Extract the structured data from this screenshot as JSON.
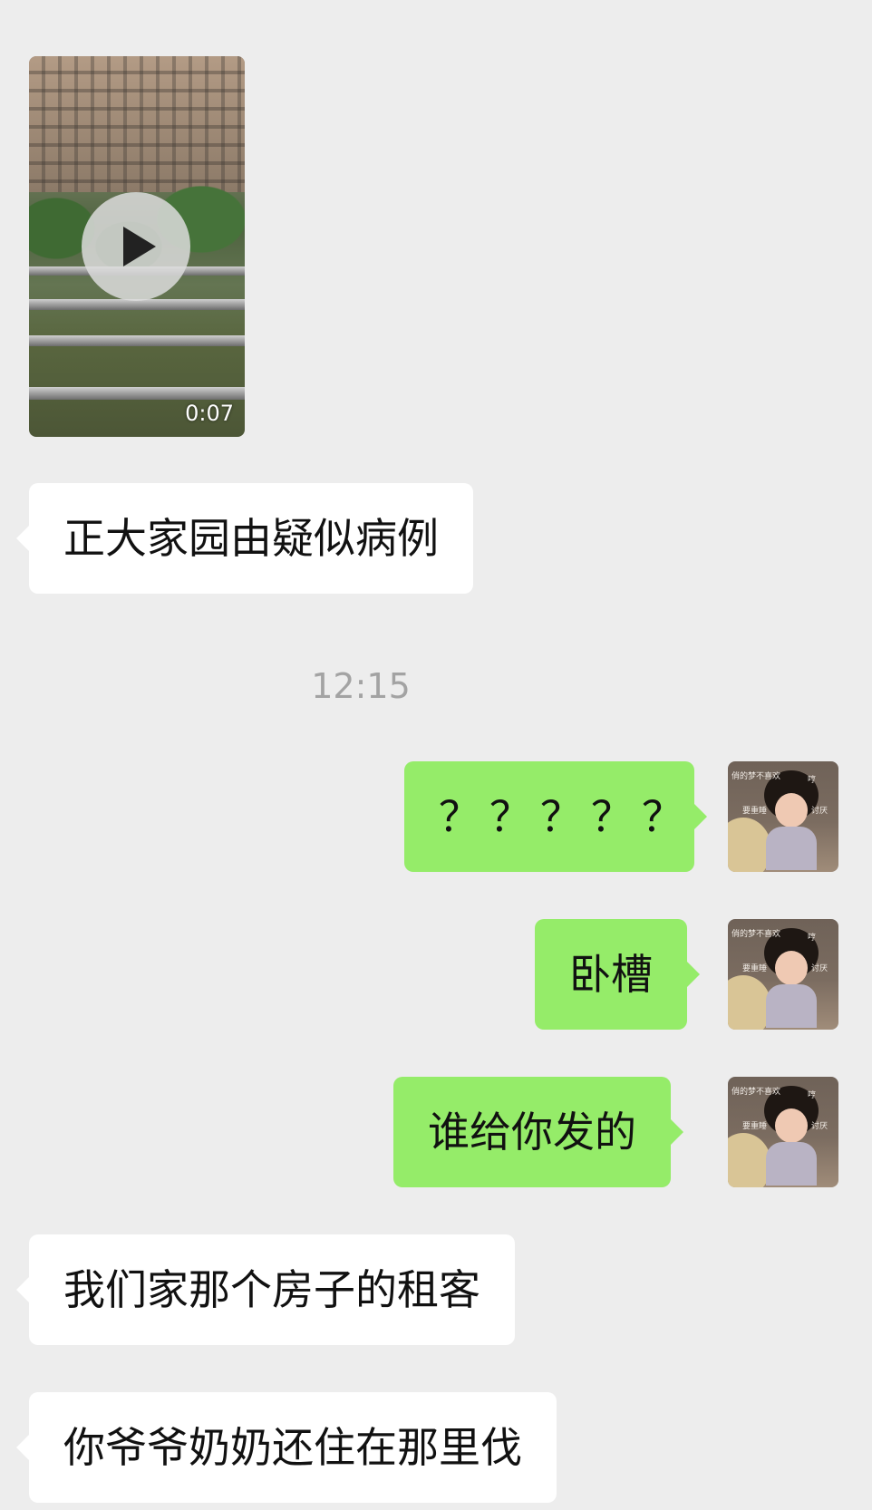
{
  "chat": {
    "video": {
      "duration": "0:07",
      "play_icon": "play-icon"
    },
    "messages": [
      {
        "side": "left",
        "text": "正大家园由疑似病例"
      },
      {
        "side": "right",
        "text": "？？？？？"
      },
      {
        "side": "right",
        "text": "卧槽"
      },
      {
        "side": "right",
        "text": "谁给你发的"
      },
      {
        "side": "left",
        "text": "我们家那个房子的租客"
      },
      {
        "side": "left",
        "text": "你爷爷奶奶还住在那里伐"
      }
    ],
    "timestamp": "12:15",
    "avatar_text": {
      "top": "俏的梦不喜欢",
      "right": "哼",
      "left": "要重睡",
      "right2": "讨厌"
    },
    "colors": {
      "background": "#ededed",
      "incoming": "#ffffff",
      "outgoing": "#95ec69",
      "timestamp": "#a3a3a3"
    }
  }
}
